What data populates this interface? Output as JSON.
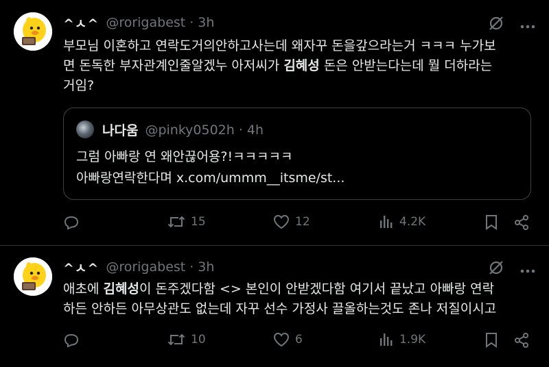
{
  "tweets": [
    {
      "name": "^ㅅ^",
      "handle": "@rorigabest",
      "dot": "·",
      "time": "3h",
      "text_1": "부모님 이혼하고 연락도거의안하고사는데 왜자꾸 돈을갚으라는거 ㅋㅋㅋ 누가보",
      "text_2a": "면 돈독한 부자관계인줄알겠누 아저씨가 ",
      "text_2b": "김혜성",
      "text_2c": " 돈은 안받는다는데 뭘 더하라는",
      "text_3": "거임?",
      "quote": {
        "name": "나다움",
        "handle": "@pinky0502h",
        "dot": "·",
        "time": "4h",
        "line_1": "그럼 아빠랑 연 왜안끊어용?!ㅋㅋㅋㅋㅋ",
        "line_2": "아빠랑연락한다며 x.com/ummm__itsme/st..."
      },
      "retweets": "15",
      "likes": "12",
      "views": "4.2K"
    },
    {
      "name": "^ㅅ^",
      "handle": "@rorigabest",
      "dot": "·",
      "time": "3h",
      "text_1a": "애초에 ",
      "text_1b": "김혜성",
      "text_1c": "이 돈주겠다함 <> 본인이 안받겠다함 여기서 끝났고 아빠랑 연락",
      "text_2": "하든 안하든 아무상관도 없는데 자꾸 선수 가정사 끌올하는것도 존나 저질이시고",
      "retweets": "10",
      "likes": "6",
      "views": "1.9K"
    }
  ],
  "icons": {
    "grok": "grok-icon",
    "more": "more-icon",
    "reply": "reply-icon",
    "retweet": "retweet-icon",
    "like": "heart-icon",
    "views": "views-icon",
    "bookmark": "bookmark-icon",
    "share": "share-icon"
  },
  "colors": {
    "background": "#000000",
    "text": "#e7e9ea",
    "muted": "#71767b",
    "border": "#2f3336"
  }
}
